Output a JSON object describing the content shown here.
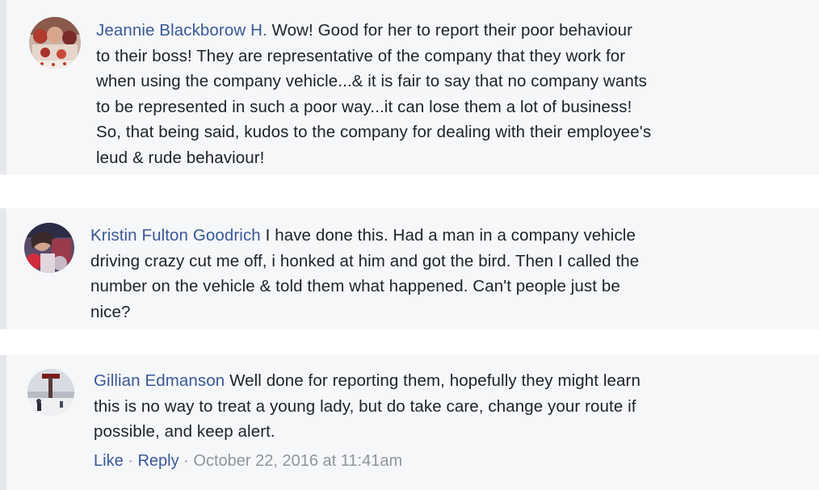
{
  "comments": [
    {
      "author": "Jeannie Blackborow H.",
      "lines": [
        " Wow! Good for her to report their poor behaviour",
        "to their boss! They are representative of the company that they work for",
        "when using the company vehicle...& it is fair to say that no company wants",
        "to be represented in such a poor way...it can lose them a lot of business!",
        "So, that being said, kudos to the company for dealing with their employee's",
        "leud & rude behaviour!"
      ]
    },
    {
      "author": "Kristin Fulton Goodrich",
      "lines": [
        " I have done this. Had a man in a company vehicle",
        "driving crazy cut me off, i honked at him and got the bird. Then I called the",
        "number on the vehicle & told them what happened. Can't people just be",
        "nice?"
      ]
    },
    {
      "author": "Gillian Edmanson",
      "lines": [
        " Well done for reporting them, hopefully they might learn",
        "this is no way to treat a young lady, but do take care, change your route if",
        "possible, and keep alert."
      ],
      "actions": {
        "like": "Like",
        "separator": " · ",
        "reply": "Reply",
        "timestamp": "October 22, 2016 at 11:41am"
      }
    }
  ]
}
